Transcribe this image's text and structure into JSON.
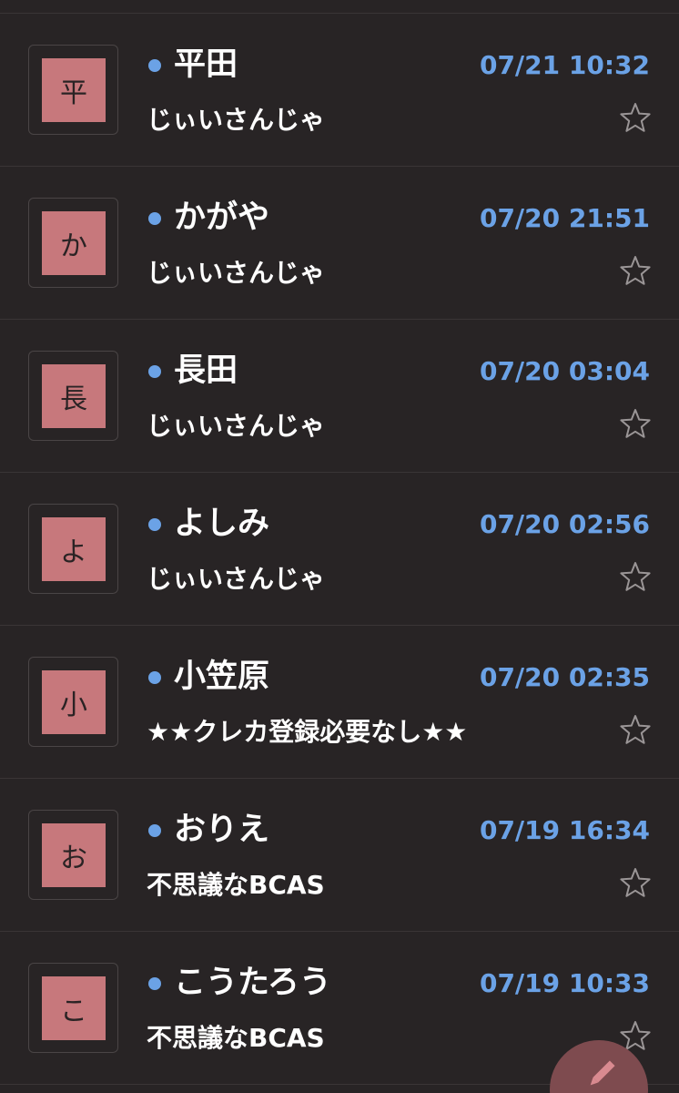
{
  "messages": [
    {
      "avatar": "平",
      "sender": "平田",
      "time": "07/21 10:32",
      "subject": "じぃいさんじゃ"
    },
    {
      "avatar": "か",
      "sender": "かがや",
      "time": "07/20 21:51",
      "subject": "じぃいさんじゃ"
    },
    {
      "avatar": "長",
      "sender": "長田",
      "time": "07/20 03:04",
      "subject": "じぃいさんじゃ"
    },
    {
      "avatar": "よ",
      "sender": "よしみ",
      "time": "07/20 02:56",
      "subject": "じぃいさんじゃ"
    },
    {
      "avatar": "小",
      "sender": "小笠原",
      "time": "07/20 02:35",
      "subject": "★★クレカ登録必要なし★★"
    },
    {
      "avatar": "お",
      "sender": "おりえ",
      "time": "07/19 16:34",
      "subject": "不思議なBCAS"
    },
    {
      "avatar": "こ",
      "sender": "こうたろう",
      "time": "07/19 10:33",
      "subject": "不思議なBCAS"
    }
  ],
  "icons": {
    "star": "star-outline-icon",
    "compose": "pencil-icon",
    "unread": "unread-dot"
  },
  "colors": {
    "background": "#282425",
    "accent": "#6ba2e6",
    "avatar": "#c7787c",
    "fab": "#7e4b4f"
  }
}
